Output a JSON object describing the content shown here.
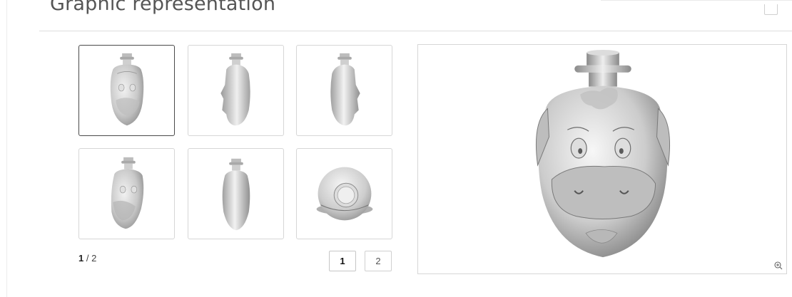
{
  "panel": {
    "title": "Graphic representation"
  },
  "gallery": {
    "thumbnails": [
      {
        "view": "front-face",
        "selected": true
      },
      {
        "view": "side-right",
        "selected": false
      },
      {
        "view": "side-left",
        "selected": false
      },
      {
        "view": "three-quarter",
        "selected": false
      },
      {
        "view": "back",
        "selected": false
      },
      {
        "view": "top",
        "selected": false
      }
    ],
    "pager": {
      "current": "1",
      "total": "/ 2",
      "pages": [
        "1",
        "2"
      ]
    }
  },
  "viewer": {
    "zoom_icon": "zoom-in-icon"
  }
}
